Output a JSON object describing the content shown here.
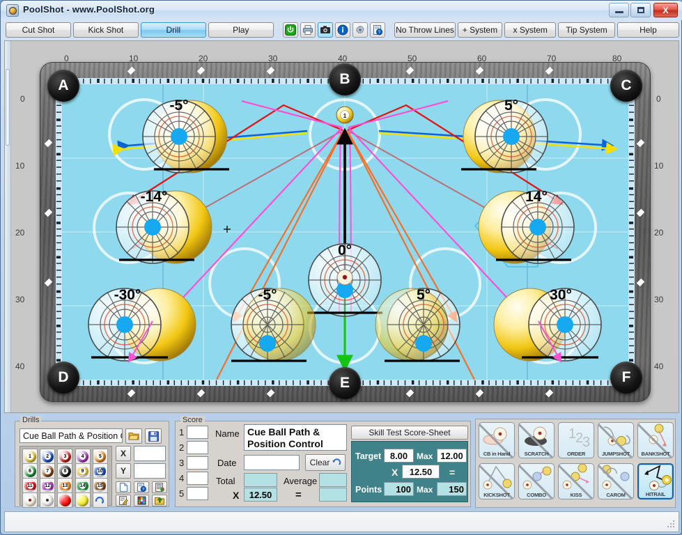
{
  "window": {
    "title": "PoolShot - www.PoolShot.org",
    "minimize_label": "–",
    "maximize_label": "□",
    "close_label": "X"
  },
  "toolbar": {
    "mode_buttons": [
      {
        "label": "Cut Shot",
        "active": false
      },
      {
        "label": "Kick Shot",
        "active": false
      },
      {
        "label": "Drill",
        "active": true
      },
      {
        "label": "Play",
        "active": false
      }
    ],
    "icon_buttons": [
      {
        "name": "power-icon",
        "glyph": "⏻",
        "color": "#1aa81a",
        "selected": false
      },
      {
        "name": "print-icon",
        "glyph": "⎙",
        "color": "#6b7c8c",
        "selected": false
      },
      {
        "name": "camera-icon",
        "glyph": "▣",
        "color": "#222222",
        "selected": true
      },
      {
        "name": "info-icon",
        "glyph": "i",
        "color": "#0b63c6",
        "selected": false
      },
      {
        "name": "gear-icon",
        "glyph": "⚙",
        "color": "#7c8b99",
        "selected": false
      },
      {
        "name": "document-help-icon",
        "glyph": "☷",
        "color": "#4a6d94",
        "selected": false
      }
    ],
    "system_buttons": [
      {
        "label": "No Throw Lines"
      },
      {
        "label": "+ System"
      },
      {
        "label": "x System"
      },
      {
        "label": "Tip System"
      },
      {
        "label": "Help"
      }
    ]
  },
  "table": {
    "top_ruler": [
      "0",
      "10",
      "20",
      "30",
      "40",
      "50",
      "60",
      "70",
      "80"
    ],
    "left_ruler": [
      "0",
      "10",
      "20",
      "30",
      "40"
    ],
    "right_ruler": [
      "0",
      "10",
      "20",
      "30",
      "40"
    ],
    "pockets": [
      {
        "label": "A"
      },
      {
        "label": "B"
      },
      {
        "label": "C"
      },
      {
        "label": "D"
      },
      {
        "label": "E"
      },
      {
        "label": "F"
      }
    ],
    "cue_ball_angles": [
      "-5°",
      "5°",
      "-14°",
      "14°",
      "-30°",
      "30°",
      "0°",
      "-5°",
      "5°"
    ],
    "object_ball_number": "1",
    "cross_marker": "x",
    "line_colors": {
      "tangent_red": "#e21414",
      "path_pink": "#ff4fd2",
      "path_orange": "#f4702a",
      "aim_blue": "#0b63d6",
      "aim_yellow": "#f3e000",
      "cue_green": "#13c413",
      "cue_black": "#000000",
      "trail_cyan": "#4ec3e8",
      "marker_blue": "#0b2fd6",
      "cloth": "#8fd9ee"
    }
  },
  "drills_panel": {
    "legend": "Drills",
    "selected_drill": "Cue Ball Path & Position Control A",
    "open_icon": "folder-open-icon",
    "save_icon": "floppy-save-icon",
    "balls": [
      {
        "n": "1",
        "color": "#f0d23a",
        "stripe": false
      },
      {
        "n": "2",
        "color": "#1a53c8",
        "stripe": false
      },
      {
        "n": "3",
        "color": "#d81f1f",
        "stripe": false
      },
      {
        "n": "4",
        "color": "#b33ccc",
        "stripe": false
      },
      {
        "n": "5",
        "color": "#f08a1e",
        "stripe": false
      },
      {
        "n": "6",
        "color": "#1f9b3c",
        "stripe": false
      },
      {
        "n": "7",
        "color": "#8a4b17",
        "stripe": false
      },
      {
        "n": "8",
        "color": "#1a1a1a",
        "stripe": false
      },
      {
        "n": "9",
        "color": "#f0d23a",
        "stripe": true
      },
      {
        "n": "10",
        "color": "#1a53c8",
        "stripe": true
      },
      {
        "n": "11",
        "color": "#d81f1f",
        "stripe": true
      },
      {
        "n": "12",
        "color": "#b33ccc",
        "stripe": true
      },
      {
        "n": "13",
        "color": "#f08a1e",
        "stripe": true
      },
      {
        "n": "14",
        "color": "#1f9b3c",
        "stripe": true
      },
      {
        "n": "15",
        "color": "#8a4b17",
        "stripe": true
      },
      {
        "n": "",
        "color": "#f2ecd8",
        "stripe": false
      },
      {
        "n": "",
        "color": "#efefef",
        "stripe": false
      },
      {
        "n": "",
        "color": "#ff0000",
        "stripe": false
      },
      {
        "n": "",
        "color": "#f5ef2a",
        "stripe": false
      },
      {
        "n": "",
        "color": "#cfe6f7",
        "stripe": false
      }
    ],
    "x_label": "X",
    "y_label": "Y",
    "x_value": "",
    "y_value": "",
    "tool_icons": [
      "new-document-icon",
      "document-help-icon",
      "table-list-icon",
      "edit-note-icon",
      "color-palette-icon",
      "export-folder-icon"
    ]
  },
  "score_panel": {
    "legend": "Score",
    "rows": [
      "1",
      "2",
      "3",
      "4",
      "5"
    ],
    "row_values": [
      "",
      "",
      "",
      "",
      ""
    ],
    "name_label": "Name",
    "name_value": "Cue Ball Path & Position Control",
    "date_label": "Date",
    "date_value": "",
    "clear_label": "Clear",
    "clear_icon": "undo-arrow-icon",
    "total_label": "Total",
    "total_value": "",
    "average_label": "Average",
    "average_value": "",
    "x_label": "X",
    "multiplier_value": "12.50",
    "equals_label": "=",
    "result_value": "",
    "scoresheet_button": "Skill Test Score-Sheet",
    "target_label": "Target",
    "target_value": "8.00",
    "target_max_label": "Max",
    "target_max_value": "12.00",
    "calc_x_label": "X",
    "calc_x_value": "12.50",
    "calc_equals": "=",
    "points_label": "Points",
    "points_value": "100",
    "points_max_label": "Max",
    "points_max_value": "150"
  },
  "action_tiles": [
    {
      "label": "CB in Hand",
      "name": "cue-ball-in-hand-tile",
      "disabled": true,
      "selected": false
    },
    {
      "label": "SCRATCH",
      "name": "scratch-tile",
      "disabled": true,
      "selected": false
    },
    {
      "label": "ORDER",
      "name": "order-tile",
      "disabled": true,
      "selected": false
    },
    {
      "label": "JUMPSHOT",
      "name": "jumpshot-tile",
      "disabled": true,
      "selected": false
    },
    {
      "label": "BANKSHOT",
      "name": "bankshot-tile",
      "disabled": true,
      "selected": false
    },
    {
      "label": "KICKSHOT",
      "name": "kickshot-tile",
      "disabled": true,
      "selected": false
    },
    {
      "label": "COMBO",
      "name": "combo-tile",
      "disabled": true,
      "selected": false
    },
    {
      "label": "KISS",
      "name": "kiss-tile",
      "disabled": true,
      "selected": false
    },
    {
      "label": "CAROM",
      "name": "carom-tile",
      "disabled": true,
      "selected": false
    },
    {
      "label": "HITRAIL",
      "name": "hitrail-tile",
      "disabled": false,
      "selected": true
    }
  ],
  "statusbar": {
    "text": ""
  }
}
